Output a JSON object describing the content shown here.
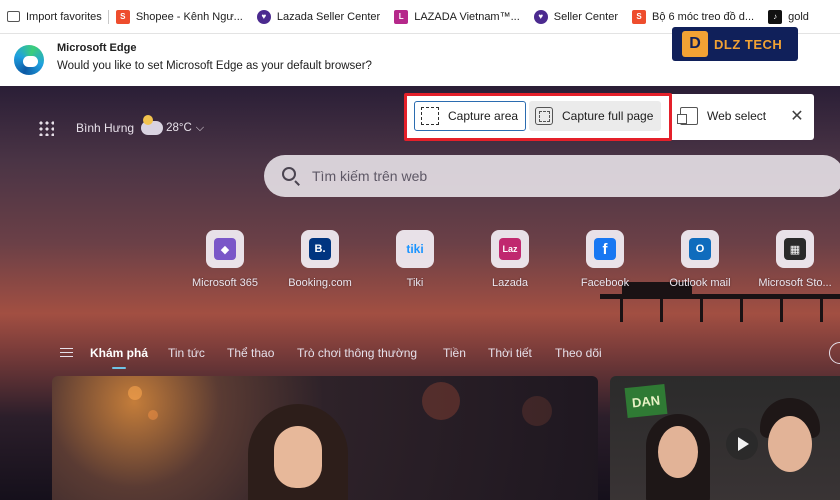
{
  "favorites": [
    {
      "label": "Import favorites",
      "icon": "import-icon",
      "color": "#555555"
    },
    {
      "label": "Shopee - Kênh Ngư...",
      "icon": "shopee-icon",
      "color": "#ee4d2d"
    },
    {
      "label": "Lazada Seller Center",
      "icon": "lazada-icon",
      "color": "#4b2a8f"
    },
    {
      "label": "LAZADA Vietnam™...",
      "icon": "lazada-vn-icon",
      "color": "#b5288a"
    },
    {
      "label": "Seller Center",
      "icon": "lazada-icon",
      "color": "#4b2a8f"
    },
    {
      "label": "Bộ 6 móc treo đồ d...",
      "icon": "shopee-icon",
      "color": "#ee4d2d"
    },
    {
      "label": "gold",
      "icon": "tiktok-icon",
      "color": "#111111"
    }
  ],
  "banner": {
    "title": "Microsoft Edge",
    "message": "Would you like to set Microsoft Edge as your default browser?"
  },
  "watermark": {
    "mark": "D",
    "text": "DLZ TECH"
  },
  "weather": {
    "location": "Bình Hưng",
    "temp": "28°C"
  },
  "capture": {
    "area_label": "Capture area",
    "full_label": "Capture full page",
    "web_label": "Web select",
    "close": "✕"
  },
  "search": {
    "placeholder": "Tìm kiếm trên web"
  },
  "quick_links": [
    {
      "label": "Microsoft 365",
      "icon": "microsoft-365-icon",
      "glyph": "◆",
      "color": "#7a56c8"
    },
    {
      "label": "Booking.com",
      "icon": "booking-icon",
      "glyph": "B.",
      "color": "#003580"
    },
    {
      "label": "Tiki",
      "icon": "tiki-icon",
      "glyph": "tiki",
      "color": "#1a94ff"
    },
    {
      "label": "Lazada",
      "icon": "lazada-icon",
      "glyph": "Laz",
      "color": "#c0286f"
    },
    {
      "label": "Facebook",
      "icon": "facebook-icon",
      "glyph": "f",
      "color": "#1877f2"
    },
    {
      "label": "Outlook mail",
      "icon": "outlook-icon",
      "glyph": "O",
      "color": "#0f6cbd"
    },
    {
      "label": "Microsoft Sto...",
      "icon": "microsoft-store-icon",
      "glyph": "▦",
      "color": "#2a2a2a"
    }
  ],
  "feed_tabs": [
    "Khám phá",
    "Tin tức",
    "Thể thao",
    "Trò chơi thông thường",
    "Tiền",
    "Thời tiết",
    "Theo dõi"
  ],
  "feed_active": "Khám phá",
  "card2_logo": "DAN"
}
